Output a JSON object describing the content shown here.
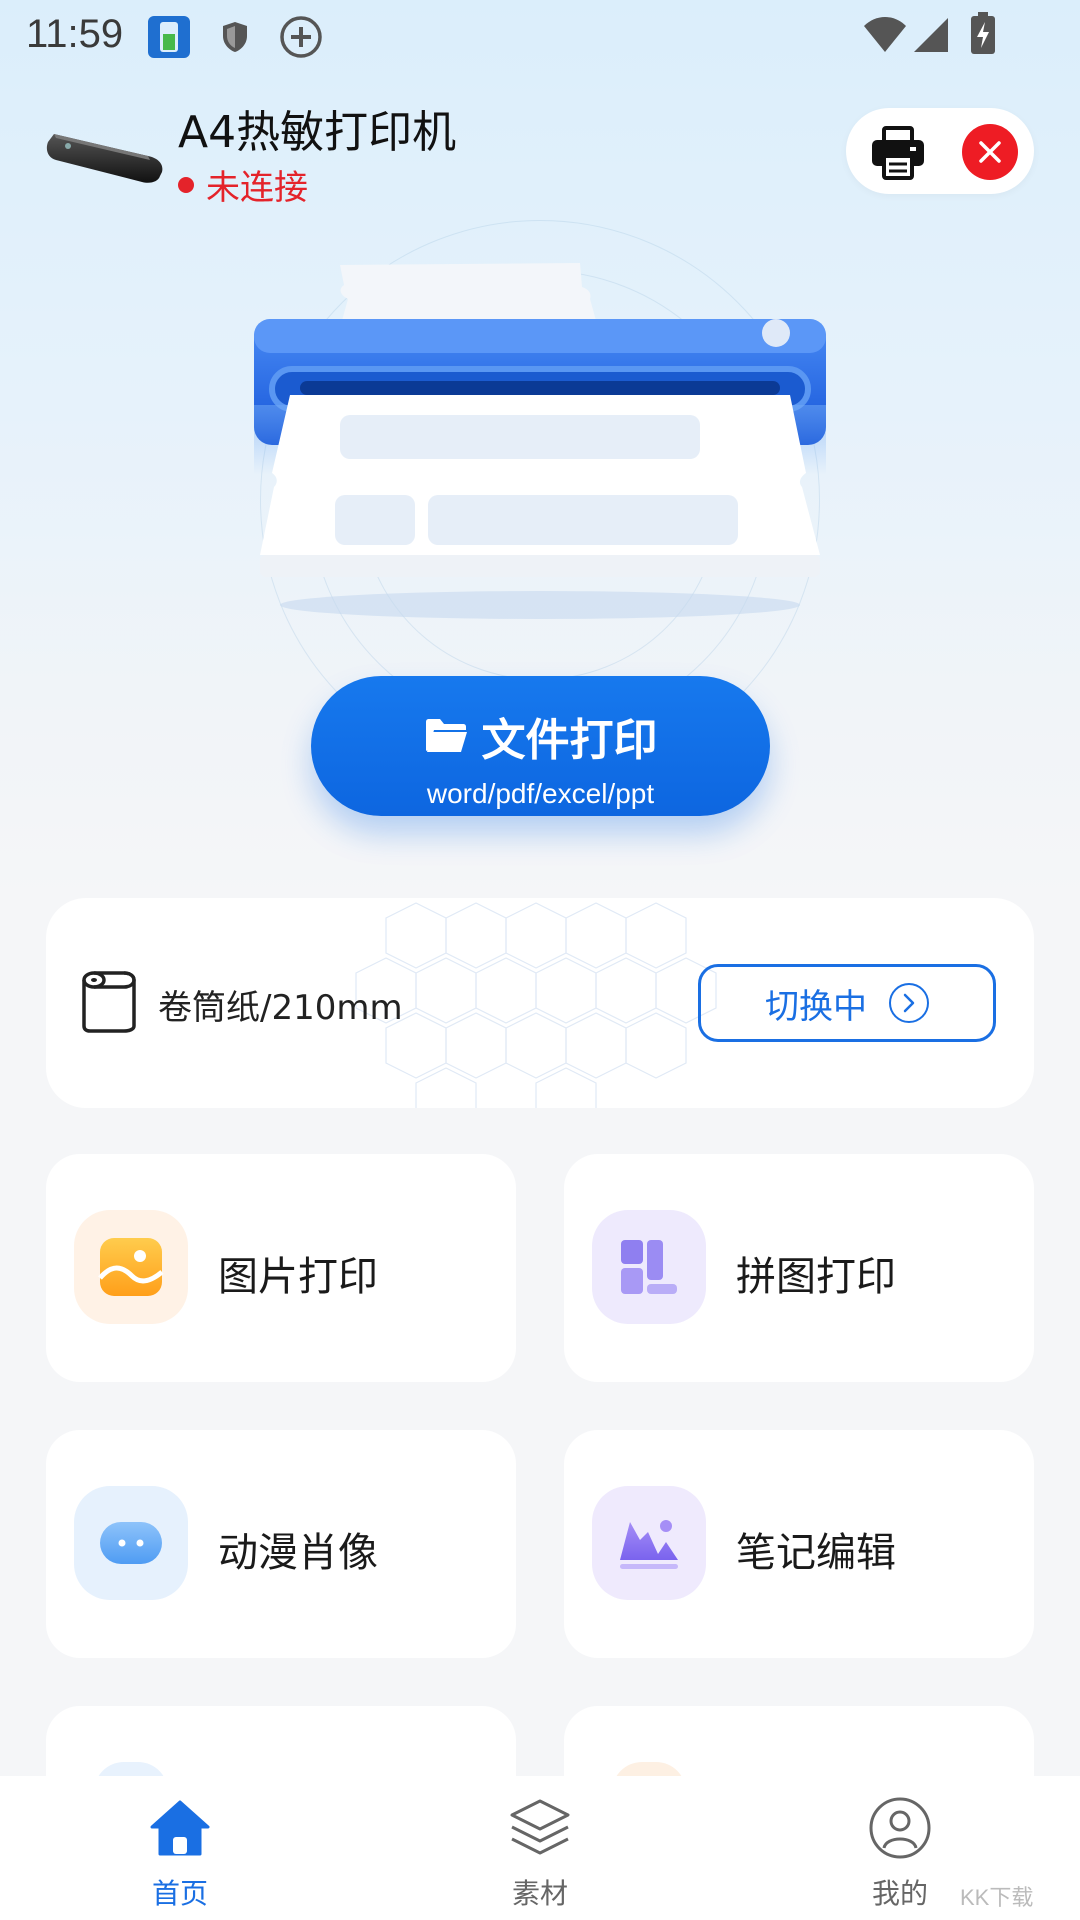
{
  "status_bar": {
    "time": "11:59"
  },
  "header": {
    "device_name": "A4热敏打印机",
    "connection_status": "未连接",
    "status_color": "#e4232a"
  },
  "file_print": {
    "title": "文件打印",
    "subtitle": "word/pdf/excel/ppt",
    "accent": "#0d66e0"
  },
  "paper": {
    "label": "卷筒纸/210mm",
    "switch_label": "切换中"
  },
  "features": [
    {
      "label": "图片打印",
      "icon": "image-icon"
    },
    {
      "label": "拼图打印",
      "icon": "collage-icon"
    },
    {
      "label": "动漫肖像",
      "icon": "anime-icon"
    },
    {
      "label": "笔记编辑",
      "icon": "note-icon"
    }
  ],
  "bottom_nav": {
    "items": [
      {
        "label": "首页",
        "icon": "home-icon",
        "active": true
      },
      {
        "label": "素材",
        "icon": "layers-icon",
        "active": false
      },
      {
        "label": "我的",
        "icon": "profile-icon",
        "active": false
      }
    ]
  },
  "watermark": "KK下载"
}
